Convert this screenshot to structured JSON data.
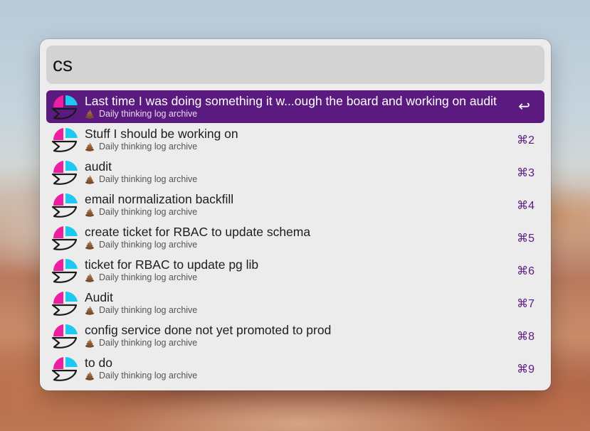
{
  "search": {
    "query": "cs"
  },
  "results": [
    {
      "title": "Last time I was doing something it w...ough the board and working on audit",
      "subtitle": "Daily thinking log archive",
      "shortcut": "↩",
      "selected": true
    },
    {
      "title": "Stuff I should be working on",
      "subtitle": "Daily thinking log archive",
      "shortcut": "⌘2",
      "selected": false
    },
    {
      "title": "audit",
      "subtitle": "Daily thinking log archive",
      "shortcut": "⌘3",
      "selected": false
    },
    {
      "title": "email normalization backfill",
      "subtitle": "Daily thinking log archive",
      "shortcut": "⌘4",
      "selected": false
    },
    {
      "title": "create ticket for RBAC to update schema",
      "subtitle": "Daily thinking log archive",
      "shortcut": "⌘5",
      "selected": false
    },
    {
      "title": "ticket for RBAC to update pg lib",
      "subtitle": "Daily thinking log archive",
      "shortcut": "⌘6",
      "selected": false
    },
    {
      "title": "Audit",
      "subtitle": "Daily thinking log archive",
      "shortcut": "⌘7",
      "selected": false
    },
    {
      "title": "config service done not yet promoted to prod",
      "subtitle": "Daily thinking log archive",
      "shortcut": "⌘8",
      "selected": false
    },
    {
      "title": "to do",
      "subtitle": "Daily thinking log archive",
      "shortcut": "⌘9",
      "selected": false
    }
  ],
  "icons": {
    "result_icon": "app-logo-icon",
    "subtitle_icon": "poop-emoji-icon"
  },
  "colors": {
    "accent": "#5b1a7f",
    "logo_magenta": "#ee1ea0",
    "logo_cyan": "#1ec8f0"
  }
}
